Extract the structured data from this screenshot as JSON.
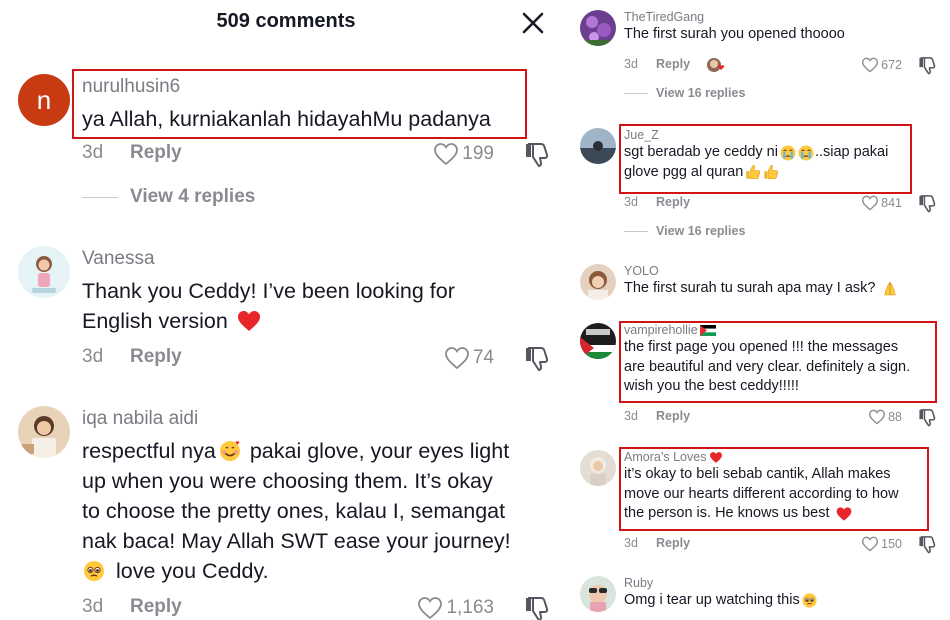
{
  "header": {
    "title": "509 comments",
    "close_icon": "close-icon"
  },
  "colors": {
    "highlight": "#d31414",
    "text": "#161823",
    "muted": "#8a8b91",
    "heart_red": "#e8262a"
  },
  "left_comments": [
    {
      "username": "nurulhusin6",
      "avatar_initial": "n",
      "lines": [
        "ya Allah, kurniakanlah hidayahMu padanya"
      ],
      "date": "3d",
      "reply_label": "Reply",
      "likes": "199",
      "view_replies": "View 4 replies"
    },
    {
      "username": "Vanessa",
      "lines": [
        "Thank you Ceddy! I’ve been looking for",
        "English version"
      ],
      "date": "3d",
      "reply_label": "Reply",
      "likes": "74"
    },
    {
      "username": "iqa nabila aidi",
      "lines": [
        "respectful nya",
        " pakai glove, your eyes light",
        "up when you were choosing them. It’s okay",
        "to choose the pretty ones, kalau I, semangat",
        "nak baca! May Allah SWT ease your journey!",
        "love you Ceddy."
      ],
      "date": "3d",
      "reply_label": "Reply",
      "likes": "1,163"
    }
  ],
  "right_comments": [
    {
      "username": "TheTiredGang",
      "lines": [
        "The first surah you opened thoooo"
      ],
      "date": "3d",
      "reply_label": "Reply",
      "likes": "672",
      "view_replies": "View 16 replies"
    },
    {
      "username": "Jue_Z",
      "lines": [
        "sgt beradab ye ceddy ni",
        "..siap pakai",
        "glove pgg al quran"
      ],
      "date": "3d",
      "reply_label": "Reply",
      "likes": "841",
      "view_replies": "View 16 replies"
    },
    {
      "username": "YOLO",
      "lines": [
        "The first surah tu surah apa may I ask?"
      ]
    },
    {
      "username": "vampirehollie",
      "lines": [
        "the first page you opened !!! the messages",
        "are beautiful and very clear. definitely a sign.",
        "wish you the best ceddy!!!!!"
      ],
      "date": "3d",
      "reply_label": "Reply",
      "likes": "88"
    },
    {
      "username": "Amora’s Loves",
      "lines": [
        "it’s okay to beli sebab cantik, Allah makes",
        "move our hearts different according to how",
        "the person is. He knows us best"
      ],
      "date": "3d",
      "reply_label": "Reply",
      "likes": "150"
    },
    {
      "username": "Ruby",
      "lines": [
        "Omg i tear up watching this"
      ]
    }
  ]
}
